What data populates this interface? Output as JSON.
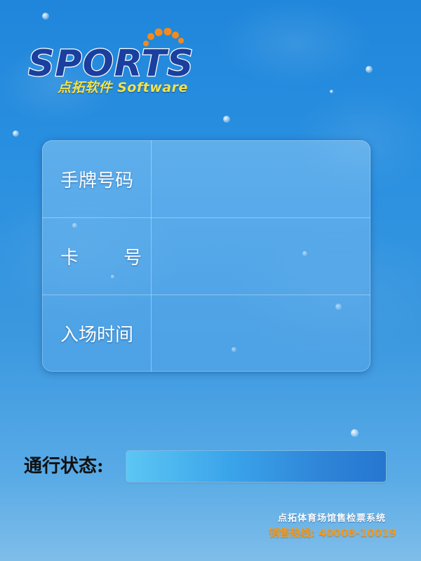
{
  "logo": {
    "wordmark": "SPORTS",
    "subtitle": "点拓软件 Software"
  },
  "fields": [
    {
      "label": "手牌号码",
      "value": ""
    },
    {
      "label_left": "卡",
      "label_right": "号",
      "value": ""
    },
    {
      "label": "入场时间",
      "value": ""
    }
  ],
  "status": {
    "label": "通行状态:",
    "value": ""
  },
  "footer": {
    "system_name": "点拓体育场馆售检票系统",
    "hotline": "销售热线: 40008-10019"
  },
  "colors": {
    "background_top": "#1f86db",
    "logo_blue": "#1b3f9e",
    "logo_orange": "#f38b1c",
    "subtitle_yellow": "#f2e34a",
    "hotline_orange": "#f39a1c",
    "status_bar": "#3aa4ea"
  }
}
